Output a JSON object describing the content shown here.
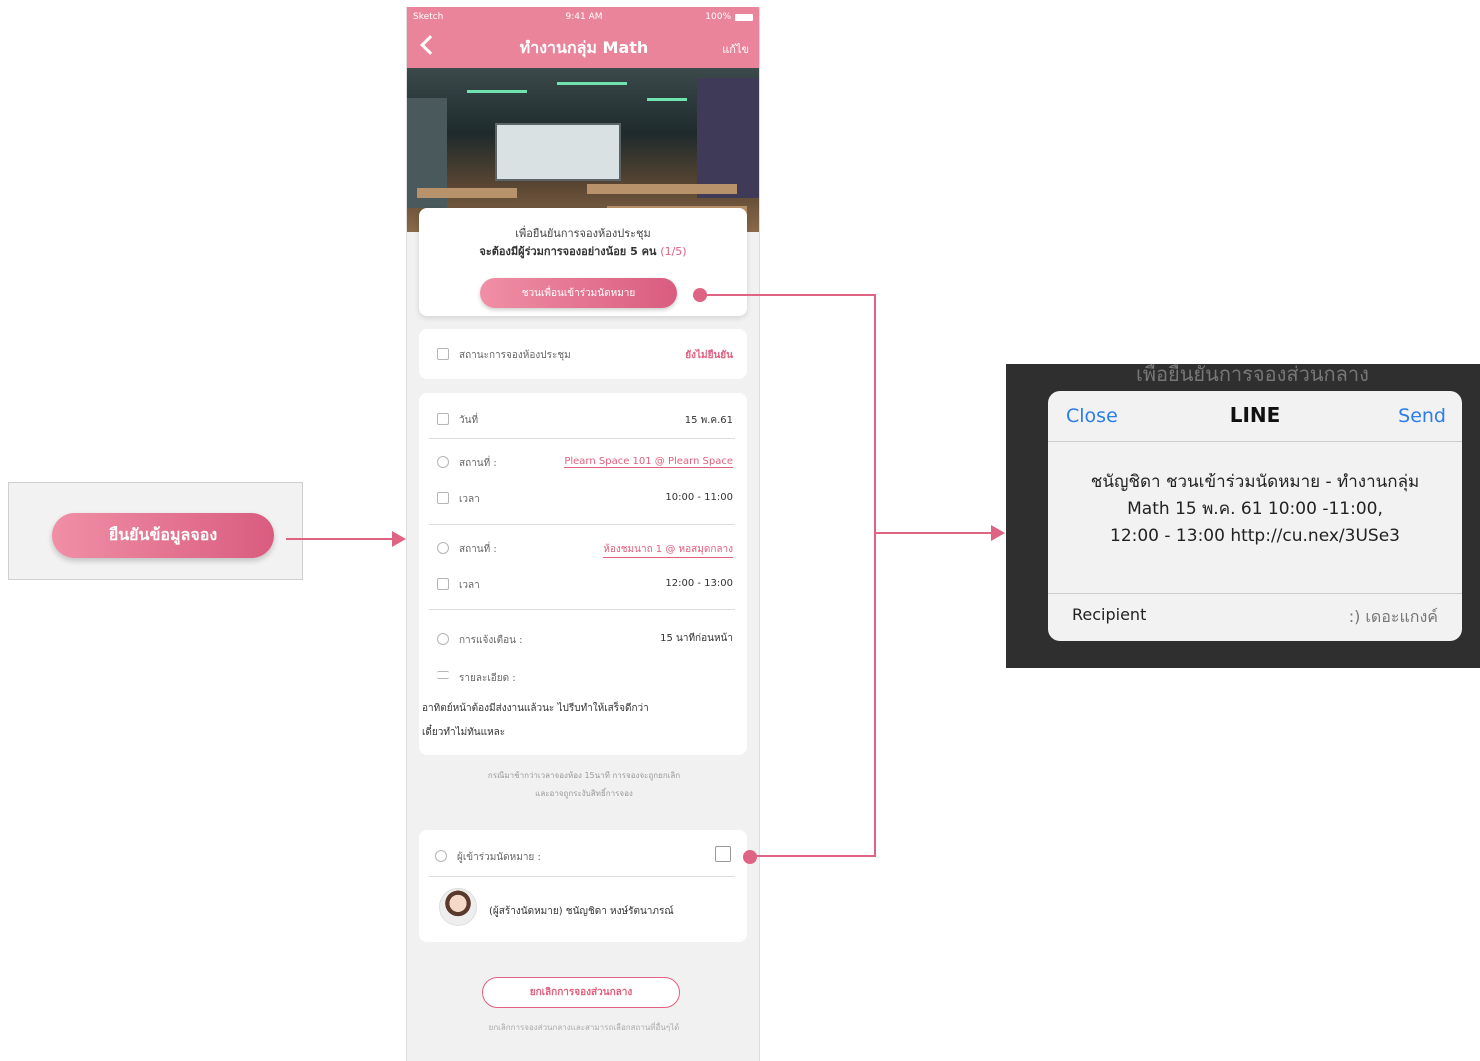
{
  "left_panel": {
    "confirm_button": "ยืนยันข้อมูลจอง"
  },
  "phone": {
    "status": {
      "carrier": "Sketch",
      "time": "9:41 AM",
      "battery": "100%"
    },
    "nav": {
      "title": "ทำงานกลุ่ม Math",
      "edit": "แก้ไข"
    },
    "promo": {
      "line1": "เพื่อยืนยันการจองห้องประชุม",
      "line2": "จะต้องมีผู้ร่วมการจองอย่างน้อย 5 คน",
      "count": "(1/5)",
      "invite_button": "ชวนเพื่อนเข้าร่วมนัดหมาย"
    },
    "booking_status": {
      "label": "สถานะการจองห้องประชุม",
      "value": "ยังไม่ยืนยัน"
    },
    "details": {
      "date_label": "วันที่",
      "date_value": "15 พ.ค.61",
      "place1_label": "สถานที่ :",
      "place1_value": "Plearn Space 101 @ Plearn Space",
      "time1_label": "เวลา",
      "time1_value": "10:00 - 11:00",
      "place2_label": "สถานที่ :",
      "place2_value": "ห้องชมนาถ 1 @ หอสมุดกลาง",
      "time2_label": "เวลา",
      "time2_value": "12:00 - 13:00",
      "reminder_label": "การแจ้งเตือน :",
      "reminder_value": "15 นาทีก่อนหน้า",
      "desc_label": "รายละเอียด :",
      "desc_line1": "อาทิตย์หน้าต้องมีส่งงานแล้วนะ ไปรีบทำให้เสร็จดีกว่า",
      "desc_line2": "เดี๋ยวทำไม่ทันแหละ"
    },
    "note_line1": "กรณีมาช้ากว่าเวลาจองห้อง 15นาที การจองจะถูกยกเลิก",
    "note_line2": "และอาจถูกระงับสิทธิ์การจอง",
    "attendees": {
      "label": "ผู้เข้าร่วมนัดหมาย :",
      "creator": "(ผู้สร้างนัดหมาย) ชนัญชิดา หงษ์รัตนาภรณ์"
    },
    "cancel_button": "ยกเลิกการจองส่วนกลาง",
    "cancel_note": "ยกเลิกการจองส่วนกลางและสามารถเลือกสถานที่อื่นๆได้"
  },
  "line_dialog": {
    "background_text": "เพื่อยืนยันการจองส่วนกลาง",
    "close": "Close",
    "title": "LINE",
    "send": "Send",
    "message_line1": "ชนัญชิดา ชวนเข้าร่วมนัดหมาย - ทำงานกลุ่ม",
    "message_line2": "Math 15 พ.ค. 61 10:00 -11:00,",
    "message_line3": "12:00 - 13:00 http://cu.nex/3USe3",
    "recipient_label": "Recipient",
    "recipient_value": ":) เดอะแกงค์"
  },
  "colors": {
    "accent": "#df6382",
    "nav_pink": "#e9849a",
    "line_blue": "#2b7de9"
  }
}
